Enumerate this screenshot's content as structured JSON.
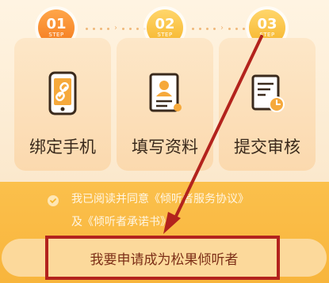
{
  "steps": [
    {
      "num": "01",
      "step_word": "STEP",
      "label": "绑定手机",
      "icon": "phone-link-icon"
    },
    {
      "num": "02",
      "step_word": "STEP",
      "label": "填写资料",
      "icon": "profile-form-icon"
    },
    {
      "num": "03",
      "step_word": "STEP",
      "label": "提交审核",
      "icon": "document-clock-icon"
    }
  ],
  "agreement": {
    "checked": true,
    "prefix": "我已阅读并同意",
    "service_agreement": "《倾听者服务协议》",
    "conjunction": "及",
    "commitment": "《倾听者承诺书》"
  },
  "apply_button": {
    "label": "我要申请成为松果倾听者"
  },
  "colors": {
    "accent_orange": "#f47b1e",
    "accent_yellow": "#f6b52b",
    "annotation_red": "#b3231d",
    "button_text": "#7d2f17"
  }
}
